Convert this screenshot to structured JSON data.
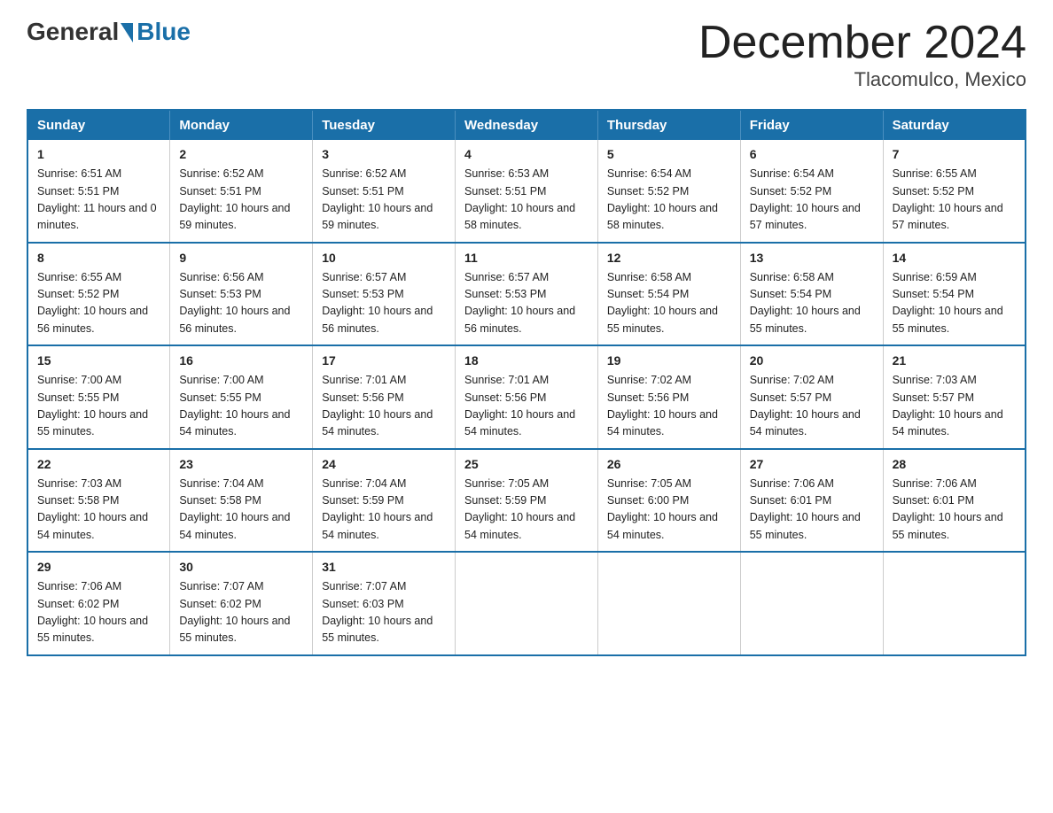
{
  "header": {
    "logo_general": "General",
    "logo_blue": "Blue",
    "month_title": "December 2024",
    "location": "Tlacomulco, Mexico"
  },
  "days_of_week": [
    "Sunday",
    "Monday",
    "Tuesday",
    "Wednesday",
    "Thursday",
    "Friday",
    "Saturday"
  ],
  "weeks": [
    [
      {
        "num": "1",
        "sunrise": "6:51 AM",
        "sunset": "5:51 PM",
        "daylight": "11 hours and 0 minutes."
      },
      {
        "num": "2",
        "sunrise": "6:52 AM",
        "sunset": "5:51 PM",
        "daylight": "10 hours and 59 minutes."
      },
      {
        "num": "3",
        "sunrise": "6:52 AM",
        "sunset": "5:51 PM",
        "daylight": "10 hours and 59 minutes."
      },
      {
        "num": "4",
        "sunrise": "6:53 AM",
        "sunset": "5:51 PM",
        "daylight": "10 hours and 58 minutes."
      },
      {
        "num": "5",
        "sunrise": "6:54 AM",
        "sunset": "5:52 PM",
        "daylight": "10 hours and 58 minutes."
      },
      {
        "num": "6",
        "sunrise": "6:54 AM",
        "sunset": "5:52 PM",
        "daylight": "10 hours and 57 minutes."
      },
      {
        "num": "7",
        "sunrise": "6:55 AM",
        "sunset": "5:52 PM",
        "daylight": "10 hours and 57 minutes."
      }
    ],
    [
      {
        "num": "8",
        "sunrise": "6:55 AM",
        "sunset": "5:52 PM",
        "daylight": "10 hours and 56 minutes."
      },
      {
        "num": "9",
        "sunrise": "6:56 AM",
        "sunset": "5:53 PM",
        "daylight": "10 hours and 56 minutes."
      },
      {
        "num": "10",
        "sunrise": "6:57 AM",
        "sunset": "5:53 PM",
        "daylight": "10 hours and 56 minutes."
      },
      {
        "num": "11",
        "sunrise": "6:57 AM",
        "sunset": "5:53 PM",
        "daylight": "10 hours and 56 minutes."
      },
      {
        "num": "12",
        "sunrise": "6:58 AM",
        "sunset": "5:54 PM",
        "daylight": "10 hours and 55 minutes."
      },
      {
        "num": "13",
        "sunrise": "6:58 AM",
        "sunset": "5:54 PM",
        "daylight": "10 hours and 55 minutes."
      },
      {
        "num": "14",
        "sunrise": "6:59 AM",
        "sunset": "5:54 PM",
        "daylight": "10 hours and 55 minutes."
      }
    ],
    [
      {
        "num": "15",
        "sunrise": "7:00 AM",
        "sunset": "5:55 PM",
        "daylight": "10 hours and 55 minutes."
      },
      {
        "num": "16",
        "sunrise": "7:00 AM",
        "sunset": "5:55 PM",
        "daylight": "10 hours and 54 minutes."
      },
      {
        "num": "17",
        "sunrise": "7:01 AM",
        "sunset": "5:56 PM",
        "daylight": "10 hours and 54 minutes."
      },
      {
        "num": "18",
        "sunrise": "7:01 AM",
        "sunset": "5:56 PM",
        "daylight": "10 hours and 54 minutes."
      },
      {
        "num": "19",
        "sunrise": "7:02 AM",
        "sunset": "5:56 PM",
        "daylight": "10 hours and 54 minutes."
      },
      {
        "num": "20",
        "sunrise": "7:02 AM",
        "sunset": "5:57 PM",
        "daylight": "10 hours and 54 minutes."
      },
      {
        "num": "21",
        "sunrise": "7:03 AM",
        "sunset": "5:57 PM",
        "daylight": "10 hours and 54 minutes."
      }
    ],
    [
      {
        "num": "22",
        "sunrise": "7:03 AM",
        "sunset": "5:58 PM",
        "daylight": "10 hours and 54 minutes."
      },
      {
        "num": "23",
        "sunrise": "7:04 AM",
        "sunset": "5:58 PM",
        "daylight": "10 hours and 54 minutes."
      },
      {
        "num": "24",
        "sunrise": "7:04 AM",
        "sunset": "5:59 PM",
        "daylight": "10 hours and 54 minutes."
      },
      {
        "num": "25",
        "sunrise": "7:05 AM",
        "sunset": "5:59 PM",
        "daylight": "10 hours and 54 minutes."
      },
      {
        "num": "26",
        "sunrise": "7:05 AM",
        "sunset": "6:00 PM",
        "daylight": "10 hours and 54 minutes."
      },
      {
        "num": "27",
        "sunrise": "7:06 AM",
        "sunset": "6:01 PM",
        "daylight": "10 hours and 55 minutes."
      },
      {
        "num": "28",
        "sunrise": "7:06 AM",
        "sunset": "6:01 PM",
        "daylight": "10 hours and 55 minutes."
      }
    ],
    [
      {
        "num": "29",
        "sunrise": "7:06 AM",
        "sunset": "6:02 PM",
        "daylight": "10 hours and 55 minutes."
      },
      {
        "num": "30",
        "sunrise": "7:07 AM",
        "sunset": "6:02 PM",
        "daylight": "10 hours and 55 minutes."
      },
      {
        "num": "31",
        "sunrise": "7:07 AM",
        "sunset": "6:03 PM",
        "daylight": "10 hours and 55 minutes."
      },
      null,
      null,
      null,
      null
    ]
  ]
}
